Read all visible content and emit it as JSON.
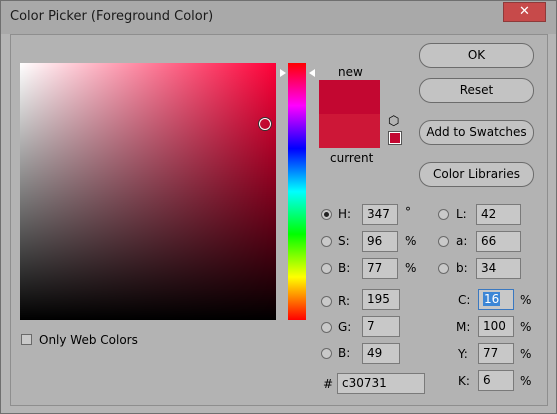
{
  "window": {
    "title": "Color Picker (Foreground Color)",
    "close_label": "✕"
  },
  "colors": {
    "new": "#c30731",
    "current": "#cd1737",
    "dialog_bg": "#b3b3b3",
    "hue_pure": "#ff0038"
  },
  "preview": {
    "new_label": "new",
    "current_label": "current",
    "cube_icon": "⬡"
  },
  "buttons": {
    "ok": "OK",
    "reset": "Reset",
    "add_swatches": "Add to Swatches",
    "color_libraries": "Color Libraries"
  },
  "hsb": {
    "h": {
      "label": "H:",
      "value": "347",
      "unit": "°",
      "selected": true
    },
    "s": {
      "label": "S:",
      "value": "96",
      "unit": "%"
    },
    "b": {
      "label": "B:",
      "value": "77",
      "unit": "%"
    }
  },
  "lab": {
    "l": {
      "label": "L:",
      "value": "42"
    },
    "a": {
      "label": "a:",
      "value": "66"
    },
    "b": {
      "label": "b:",
      "value": "34"
    }
  },
  "rgb": {
    "r": {
      "label": "R:",
      "value": "195"
    },
    "g": {
      "label": "G:",
      "value": "7"
    },
    "b": {
      "label": "B:",
      "value": "49"
    }
  },
  "cmyk": {
    "c": {
      "label": "C:",
      "value": "16",
      "unit": "%"
    },
    "m": {
      "label": "M:",
      "value": "100",
      "unit": "%"
    },
    "y": {
      "label": "Y:",
      "value": "77",
      "unit": "%"
    },
    "k": {
      "label": "K:",
      "value": "6",
      "unit": "%"
    }
  },
  "hex": {
    "label": "#",
    "value": "c30731"
  },
  "web_colors": {
    "label": "Only Web Colors",
    "checked": false
  },
  "hue_slider": {
    "hue_degrees": 347
  }
}
